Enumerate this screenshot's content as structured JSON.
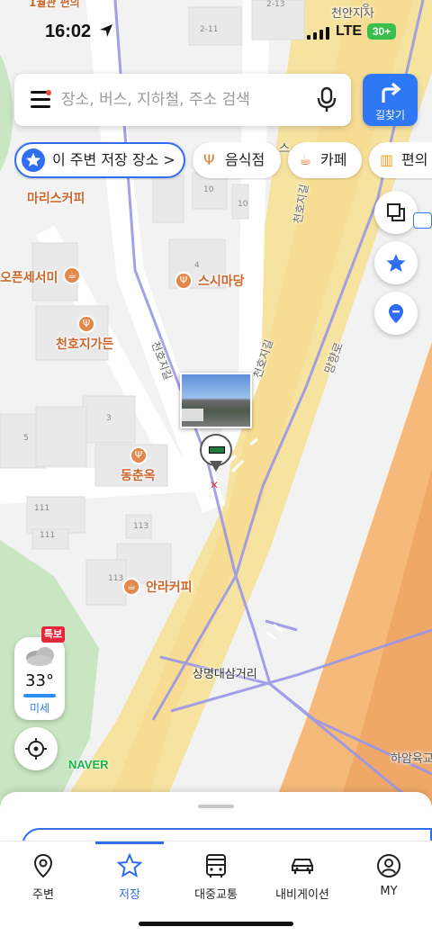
{
  "status_bar": {
    "time": "16:02",
    "network": "LTE",
    "battery": "30+"
  },
  "search": {
    "placeholder": "장소, 버스, 지하철, 주소 검색"
  },
  "route_button": {
    "label": "길찾기"
  },
  "chips": [
    {
      "label": "이 주변 저장 장소 >",
      "icon": "star-icon"
    },
    {
      "label": "음식점",
      "icon": "fork-knife-icon"
    },
    {
      "label": "카페",
      "icon": "cup-icon"
    },
    {
      "label": "편의",
      "icon": "store-icon"
    }
  ],
  "map": {
    "labels": {
      "top_branch": "천안지사",
      "marris_coffee": "마리스커피",
      "open_sesame": "오픈세서미",
      "sushi": "스시마당",
      "cheonhoji_garden": "천호지가든",
      "dongchunok": "동춘옥",
      "anra_coffee": "안라커피",
      "intersection": "상명대삼거리",
      "road_cheonhoji_1": "천호지길",
      "road_cheonhoji_2": "천호지길",
      "road_cheonhoji_3": "천호지길",
      "road_manghyang": "망향로",
      "haam": "하암육교",
      "stub_top": "스",
      "stub_partial": "1월관 편의"
    },
    "building_numbers": [
      "2-11",
      "2-13",
      "10",
      "10",
      "4",
      "3",
      "5",
      "111",
      "111",
      "113",
      "113"
    ],
    "colors": {
      "highway": "#f5b97a",
      "main_road": "#f7e3a0",
      "road_line": "#9a97e6",
      "park": "#c7e6c1"
    }
  },
  "weather": {
    "alert": "특보",
    "temperature": "33°",
    "dust": "미세"
  },
  "brand": {
    "logo": "NAVER"
  },
  "tabs": [
    {
      "label": "주변",
      "icon": "location-pin-icon",
      "active": false
    },
    {
      "label": "저장",
      "icon": "star-outline-icon",
      "active": true
    },
    {
      "label": "대중교통",
      "icon": "bus-icon",
      "active": false
    },
    {
      "label": "내비게이션",
      "icon": "car-icon",
      "active": false
    },
    {
      "label": "MY",
      "icon": "user-icon",
      "active": false
    }
  ],
  "accent_color": "#2f6ef0"
}
